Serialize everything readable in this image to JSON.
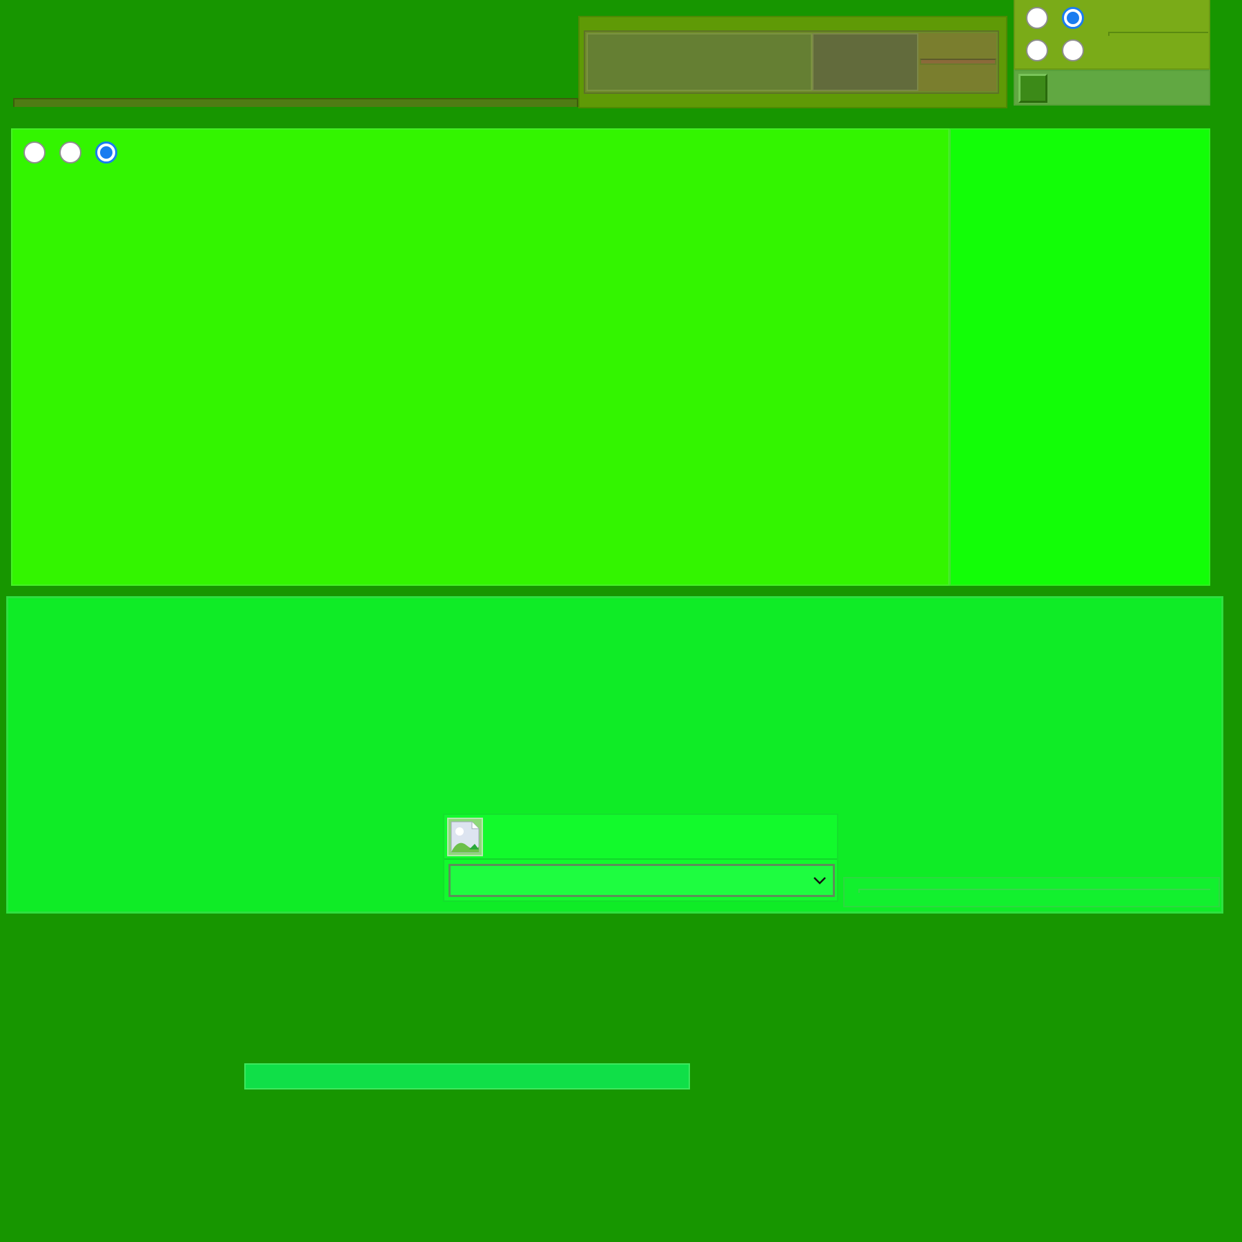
{
  "top_left": {
    "strip": {}
  },
  "top_panel": {
    "slider": {
      "value_fraction": 0.0
    }
  },
  "top_right": {
    "radios": [
      {
        "selected": false
      },
      {
        "selected": true
      },
      {
        "selected": false
      },
      {
        "selected": false
      }
    ]
  },
  "main": {
    "radios": [
      {
        "selected": false
      },
      {
        "selected": false
      },
      {
        "selected": true
      }
    ]
  },
  "lower": {
    "image_icon": "image-icon",
    "dropdown": {
      "selected_value": "",
      "chevron_icon": "chevron-down-icon"
    },
    "text_field": {
      "value": ""
    }
  },
  "colors": {
    "background": "#179600",
    "main_panel": "#33f500",
    "side_panel": "#12fe07",
    "lower_panel": "#0fec26",
    "radio_accent": "#1a7cf0"
  }
}
